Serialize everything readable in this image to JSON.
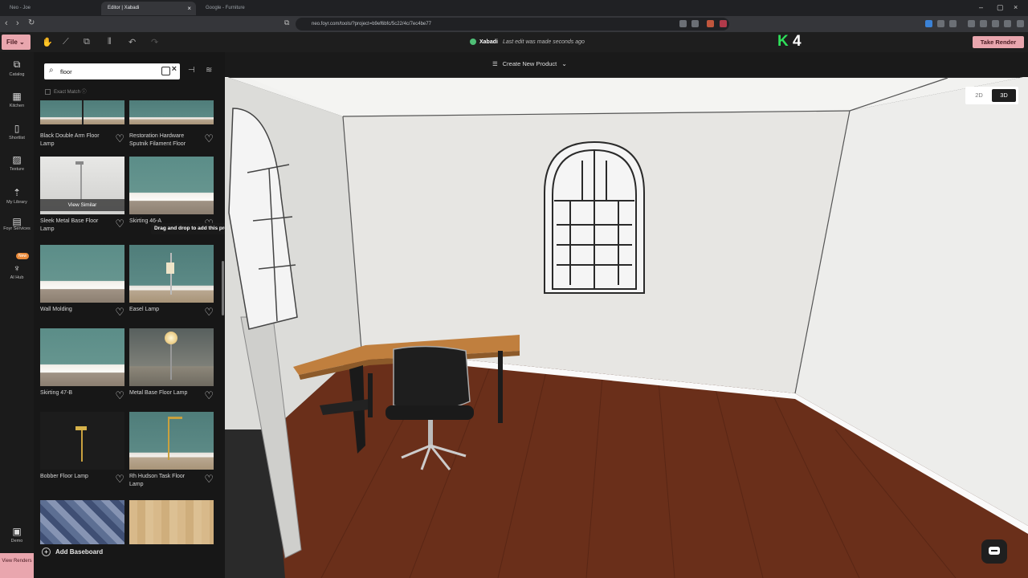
{
  "browser": {
    "tabs": [
      {
        "label": "Neo - Joe"
      },
      {
        "label": "Editor | Xabadi"
      },
      {
        "label": "Google - Furniture"
      }
    ],
    "url": "neo.foyr.com/tools/?project=b9ef6bfc/5c22/4c/7ec4be77"
  },
  "toolbar": {
    "file_label": "File ⌄",
    "project_name": "Xabadi",
    "last_edit": "Last edit was made seconds ago",
    "k_count": "4",
    "take_render": "Take Render"
  },
  "rail": {
    "items": [
      {
        "icon": "catalog-icon",
        "label": "Catalog"
      },
      {
        "icon": "kitchen-icon",
        "label": "Kitchen"
      },
      {
        "icon": "shortlist-icon",
        "label": "Shortlist"
      },
      {
        "icon": "texture-icon",
        "label": "Texture"
      },
      {
        "icon": "upload-icon",
        "label": "My Library"
      },
      {
        "icon": "services-icon",
        "label": "Foyr Services"
      },
      {
        "icon": "ai-hub-icon",
        "label": "AI Hub"
      },
      {
        "icon": "demo-icon",
        "label": "Demo"
      }
    ],
    "new_badge": "New",
    "view_renders": "View Renders"
  },
  "catalog": {
    "search_value": "floor",
    "exact_match": "Exact Match",
    "products": [
      {
        "name": "Black Double Arm Floor Lamp"
      },
      {
        "name": "Restoration Hardware Sputnik Filament Floor"
      },
      {
        "name": "Sleek Metal Base Floor Lamp"
      },
      {
        "name": "Skirting 46-A"
      },
      {
        "name": "Wall Molding"
      },
      {
        "name": "Easel Lamp"
      },
      {
        "name": "Skirting 47-B"
      },
      {
        "name": "Metal Base Floor Lamp"
      },
      {
        "name": "Bobber Floor Lamp"
      },
      {
        "name": "Rh Hudson Task Floor Lamp"
      }
    ],
    "view_similar": "View Similar",
    "tooltip": "Drag and drop to add this product",
    "add_baseboard": "Add Baseboard"
  },
  "viewport": {
    "create_new": "Create New Product",
    "view_2d": "2D",
    "view_3d": "3D",
    "active_view": "3D"
  },
  "colors": {
    "accent_pink": "#e9a6ae",
    "status_green": "#4fbf76",
    "k_logo_green": "#2ee05a"
  }
}
